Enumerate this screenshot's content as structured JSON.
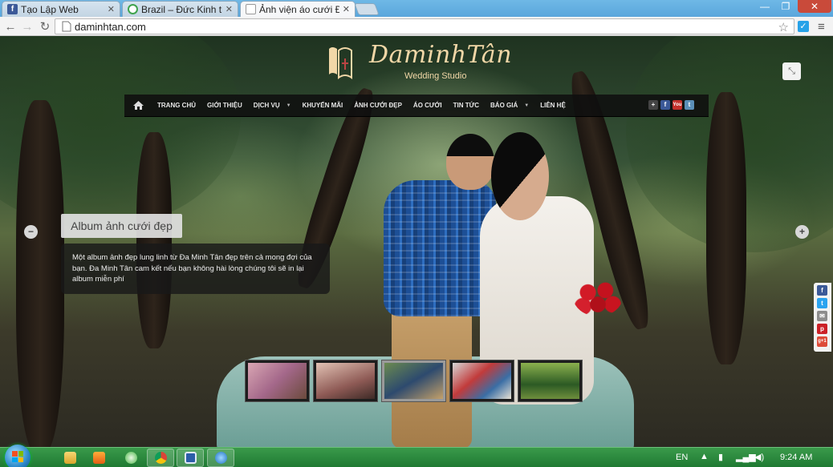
{
  "browser": {
    "tabs": [
      {
        "title": "Tạo Lập Web",
        "favicon": "facebook-icon",
        "active": false
      },
      {
        "title": "Brazil – Đức Kinh thiê",
        "favicon": "loading-icon",
        "active": false
      },
      {
        "title": "Ảnh viện áo cưới Đa",
        "favicon": "page-icon",
        "active": true
      }
    ],
    "url": "daminhtan.com",
    "window_controls": {
      "minimize": "—",
      "maximize": "❐",
      "close": "✕"
    }
  },
  "site": {
    "logo_name": "DaminhTân",
    "logo_sub": "Wedding Studio",
    "nav": [
      {
        "label": "TRANG CHỦ",
        "dropdown": false
      },
      {
        "label": "GIỚI THIỆU",
        "dropdown": false
      },
      {
        "label": "DỊCH VỤ",
        "dropdown": true
      },
      {
        "label": "KHUYẾN MÃI",
        "dropdown": false
      },
      {
        "label": "ẢNH CƯỚI ĐẸP",
        "dropdown": false
      },
      {
        "label": "ÁO CƯỚI",
        "dropdown": false
      },
      {
        "label": "TIN TỨC",
        "dropdown": false
      },
      {
        "label": "BÁO GIÁ",
        "dropdown": true
      },
      {
        "label": "LIÊN HỆ",
        "dropdown": false
      }
    ],
    "social_top": [
      "plus-icon",
      "facebook-icon",
      "youtube-icon",
      "twitter-icon"
    ],
    "slide": {
      "caption_title": "Album ảnh cưới đẹp",
      "caption_text": "Một album ảnh đẹp lung linh từ Đa Minh Tân đẹp trên cả mong đợi của bạn. Đa Minh Tân cam kết nếu bạn không hài lòng chúng tôi sẽ in lại album miễn phí",
      "prev_label": "−",
      "next_label": "+",
      "thumbnail_count": 5,
      "active_thumbnail": 3
    },
    "share_bar": [
      {
        "icon": "facebook-icon",
        "glyph": "f",
        "color": "#3b5998"
      },
      {
        "icon": "twitter-icon",
        "glyph": "t",
        "color": "#2aa3ef"
      },
      {
        "icon": "email-icon",
        "glyph": "✉",
        "color": "#8c8c8c"
      },
      {
        "icon": "pinterest-icon",
        "glyph": "p",
        "color": "#cb2027"
      },
      {
        "icon": "google-plus-icon",
        "glyph": "g+1",
        "color": "#dd4b39"
      }
    ]
  },
  "taskbar": {
    "language": "EN",
    "time": "9:24 AM"
  },
  "colors": {
    "nav_bg": "#0f0f0f",
    "logo_gold": "#f1d7a7",
    "taskbar_green": "#2a8a3e"
  }
}
